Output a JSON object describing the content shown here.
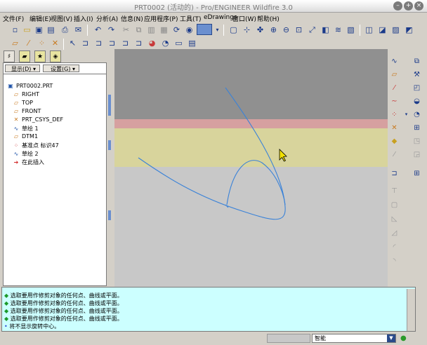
{
  "window": {
    "title": "PRT0002 (活动的) - Pro/ENGINEER Wildfire 3.0"
  },
  "menu": [
    "文件(F)",
    "编辑(E)",
    "视图(V)",
    "插入(I)",
    "分析(A)",
    "信息(N)",
    "应用程序(P)",
    "工具(T)",
    "eDrawings",
    "窗口(W)",
    "帮助(H)"
  ],
  "panel": {
    "show_label": "显示(D)",
    "settings_label": "设置(G)",
    "tree": [
      {
        "label": "PRT0002.PRT",
        "icon": "part-icon"
      },
      {
        "label": "RIGHT",
        "icon": "datum-plane-icon"
      },
      {
        "label": "TOP",
        "icon": "datum-plane-icon"
      },
      {
        "label": "FRONT",
        "icon": "datum-plane-icon"
      },
      {
        "label": "PRT_CSYS_DEF",
        "icon": "csys-icon"
      },
      {
        "label": "草绘 1",
        "icon": "sketch-icon"
      },
      {
        "label": "DTM1",
        "icon": "datum-plane-icon"
      },
      {
        "label": "基准点 标识47",
        "icon": "datum-point-icon"
      },
      {
        "label": "草绘 2",
        "icon": "sketch-icon"
      },
      {
        "label": "在此插入",
        "icon": "insert-arrow-icon"
      }
    ]
  },
  "messages": [
    "选取要用作修剪对象的任何点、曲线或平面。",
    "选取要用作修剪对象的任何点、曲线或平面。",
    "选取要用作修剪对象的任何点、曲线或平面。",
    "选取要用作修剪对象的任何点、曲线或平面。",
    "将不显示旋转中心。"
  ],
  "status": {
    "filter": "智能"
  },
  "colors": {
    "graphics_bg": "#c8c8c8",
    "upper_bg": "#909090",
    "pink_plane": "#d6a0a0",
    "yellow_plane": "#d8d49c",
    "curve": "#3a82d8",
    "message_bg": "#ccffff"
  }
}
